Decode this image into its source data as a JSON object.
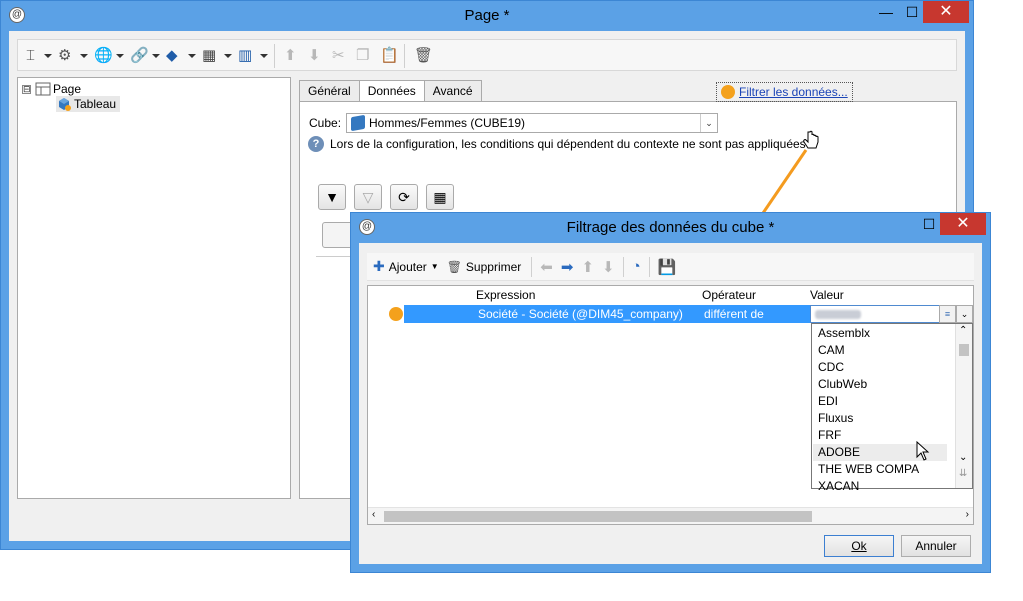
{
  "main_window": {
    "title": "Page *",
    "app_icon": "app-logo-icon",
    "controls": {
      "minimize": "—",
      "maximize": "☐",
      "close": "✕"
    }
  },
  "toolbar": {
    "icons": [
      "text-cursor-icon",
      "filter-settings-icon",
      "globe-icon",
      "link-icon",
      "cube-icon",
      "table-grid-icon",
      "columns-icon",
      "arrow-up-icon",
      "arrow-down-icon",
      "cut-icon",
      "copy-icon",
      "paste-icon",
      "delete-icon"
    ]
  },
  "tree": {
    "root": {
      "label": "Page",
      "expander": "⊟"
    },
    "child": {
      "label": "Tableau"
    }
  },
  "tabs": [
    {
      "label": "Général"
    },
    {
      "label": "Données",
      "active": true
    },
    {
      "label": "Avancé"
    }
  ],
  "form": {
    "cube_label": "Cube:",
    "cube_value": "Hommes/Femmes (CUBE19)",
    "filter_link": "Filtrer les données...",
    "info_text": "Lors de la configuration, les conditions qui dépendent du contexte ne sont pas appliquées"
  },
  "dialog": {
    "title": "Filtrage des données du cube *",
    "toolbar": {
      "add_label": "Ajouter",
      "delete_label": "Supprimer"
    },
    "grid": {
      "columns": [
        "Expression",
        "Opérateur",
        "Valeur"
      ],
      "row": {
        "expression": "Société - Société (@DIM45_company)",
        "operator": "différent de",
        "value": ""
      }
    },
    "dropdown_options": [
      "Assemblx",
      "CAM",
      "CDC",
      "ClubWeb",
      "EDI",
      "Fluxus",
      "FRF",
      "ADOBE",
      "THE WEB COMPA",
      "XACAN"
    ],
    "hovered_option": "ADOBE",
    "ok_label": "Ok",
    "cancel_label": "Annuler"
  },
  "colors": {
    "window_frame": "#5ba1e6",
    "close_button": "#c7372f",
    "selection": "#3399ff",
    "status_dot": "#f4a11c",
    "annotation_arrow": "#f49b1f",
    "link": "#1a44b7"
  }
}
